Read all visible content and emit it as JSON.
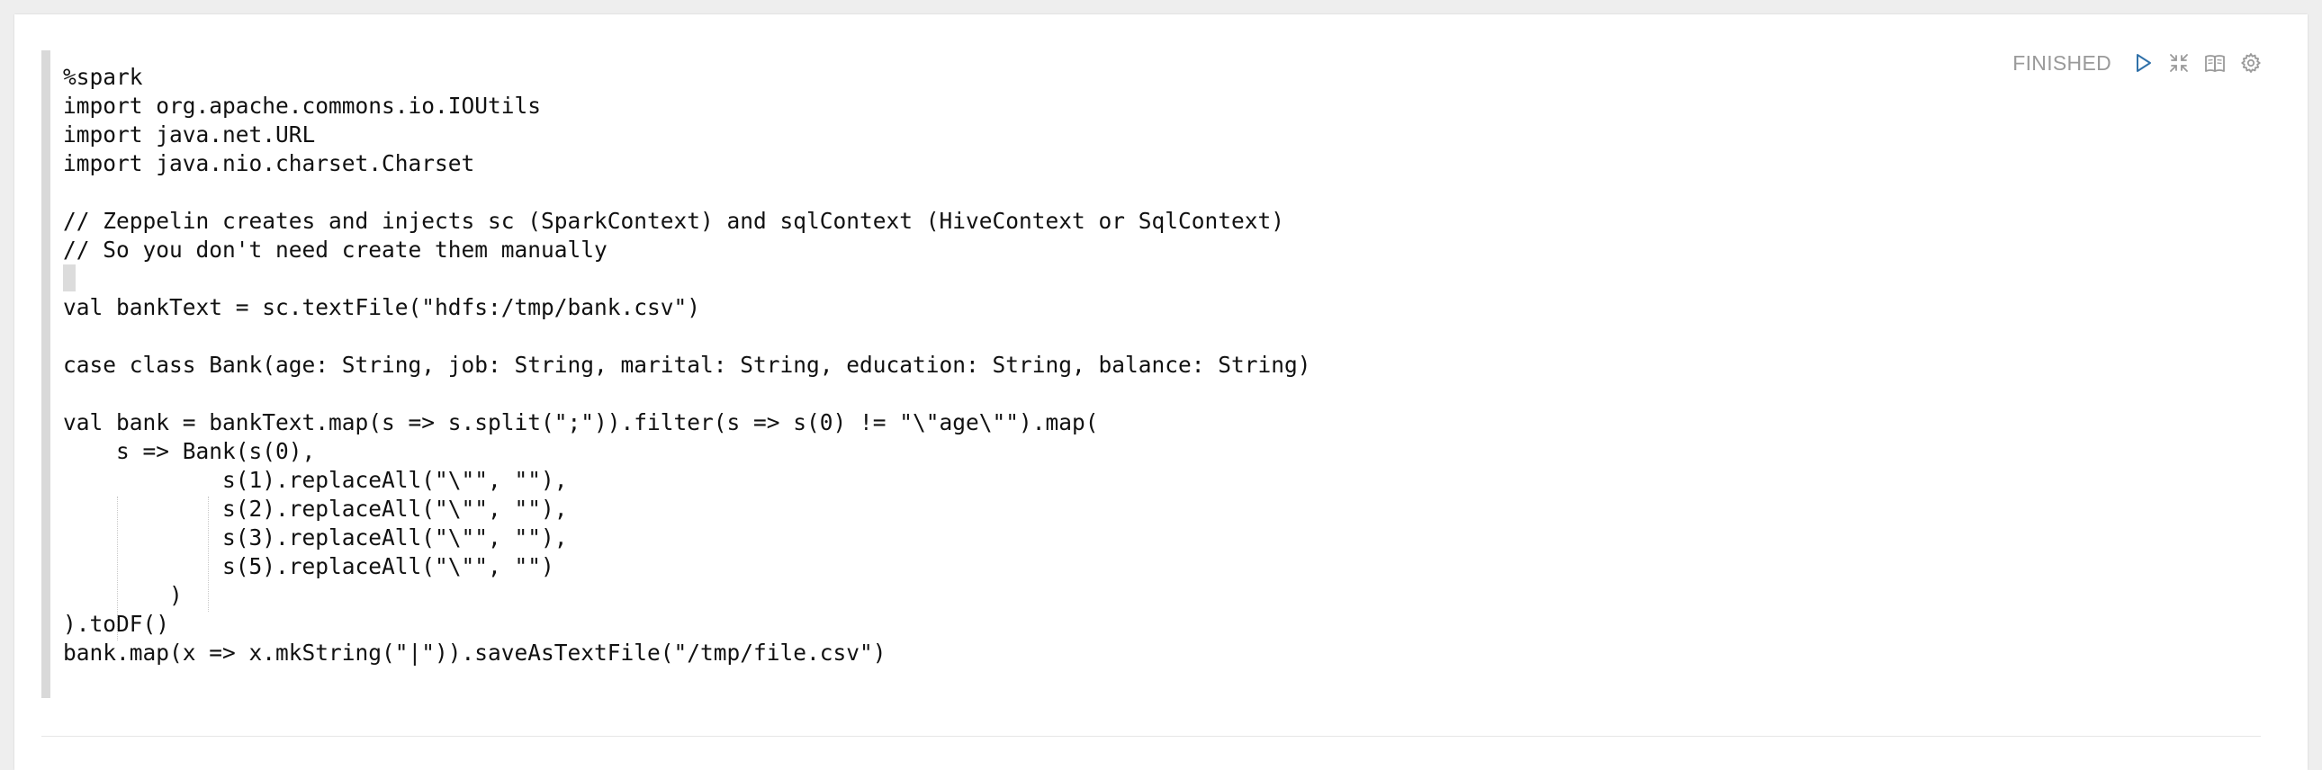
{
  "paragraph": {
    "status": "FINISHED",
    "code_lines": [
      "%spark",
      "import org.apache.commons.io.IOUtils",
      "import java.net.URL",
      "import java.nio.charset.Charset",
      "",
      "// Zeppelin creates and injects sc (SparkContext) and sqlContext (HiveContext or SqlContext)",
      "// So you don't need create them manually",
      "",
      "val bankText = sc.textFile(\"hdfs:/tmp/bank.csv\")",
      "",
      "case class Bank(age: String, job: String, marital: String, education: String, balance: String)",
      "",
      "val bank = bankText.map(s => s.split(\";\")).filter(s => s(0) != \"\\\"age\\\"\").map(",
      "    s => Bank(s(0),",
      "            s(1).replaceAll(\"\\\"\", \"\"),",
      "            s(2).replaceAll(\"\\\"\", \"\"),",
      "            s(3).replaceAll(\"\\\"\", \"\"),",
      "            s(5).replaceAll(\"\\\"\", \"\")",
      "        )",
      ").toDF()",
      "bank.map(x => x.mkString(\"|\")).saveAsTextFile(\"/tmp/file.csv\")"
    ]
  },
  "toolbar": {
    "icons": [
      "run-icon",
      "collapse-icon",
      "book-icon",
      "gear-icon"
    ],
    "accent_color": "#3071a9",
    "icon_color": "#9a9a9a"
  }
}
